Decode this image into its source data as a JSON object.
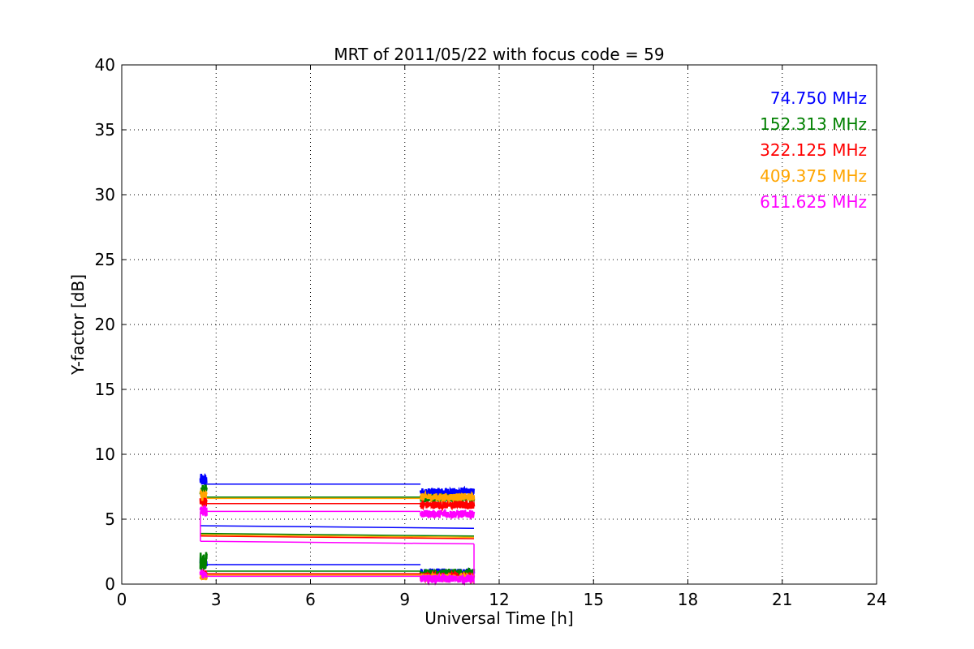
{
  "chart_data": {
    "type": "line",
    "title": "MRT of 2011/05/22 with focus code = 59",
    "xlabel": "Universal Time [h]",
    "ylabel": "Y-factor [dB]",
    "xlim": [
      0,
      24
    ],
    "ylim": [
      0,
      40
    ],
    "xticks": [
      0,
      3,
      6,
      9,
      12,
      15,
      18,
      21,
      24
    ],
    "yticks": [
      0,
      5,
      10,
      15,
      20,
      25,
      30,
      35,
      40
    ],
    "grid": true,
    "legend_position": "top-right",
    "series": [
      {
        "name": "74.750 MHz",
        "color": "#0000ff",
        "segments": [
          {
            "kind": "noisy",
            "x0": 2.5,
            "x1": 2.7,
            "center": 8.0,
            "amp": 0.5
          },
          {
            "kind": "noisy",
            "x0": 2.5,
            "x1": 2.7,
            "center": 1.7,
            "amp": 0.4
          },
          {
            "kind": "line",
            "x": [
              2.7,
              9.5
            ],
            "y": [
              7.7,
              7.7
            ]
          },
          {
            "kind": "line",
            "x": [
              2.7,
              9.5
            ],
            "y": [
              1.5,
              1.5
            ]
          },
          {
            "kind": "line",
            "x": [
              2.5,
              11.2
            ],
            "y": [
              4.5,
              4.3
            ]
          },
          {
            "kind": "noisy",
            "x0": 9.5,
            "x1": 11.2,
            "center": 7.1,
            "amp": 0.3
          },
          {
            "kind": "noisy",
            "x0": 9.5,
            "x1": 11.2,
            "center": 0.9,
            "amp": 0.3
          }
        ]
      },
      {
        "name": "152.313 MHz",
        "color": "#008000",
        "segments": [
          {
            "kind": "noisy",
            "x0": 2.5,
            "x1": 2.7,
            "center": 7.2,
            "amp": 0.5
          },
          {
            "kind": "noisy",
            "x0": 2.5,
            "x1": 2.7,
            "center": 1.8,
            "amp": 0.7
          },
          {
            "kind": "line",
            "x": [
              2.7,
              9.5
            ],
            "y": [
              6.7,
              6.7
            ]
          },
          {
            "kind": "line",
            "x": [
              2.7,
              9.5
            ],
            "y": [
              1.0,
              1.0
            ]
          },
          {
            "kind": "line",
            "x": [
              2.5,
              11.2
            ],
            "y": [
              3.9,
              3.7
            ]
          },
          {
            "kind": "noisy",
            "x0": 9.5,
            "x1": 11.2,
            "center": 6.6,
            "amp": 0.3
          },
          {
            "kind": "noisy",
            "x0": 9.5,
            "x1": 11.2,
            "center": 0.8,
            "amp": 0.4
          }
        ]
      },
      {
        "name": "322.125 MHz",
        "color": "#ff0000",
        "segments": [
          {
            "kind": "noisy",
            "x0": 2.5,
            "x1": 2.7,
            "center": 6.3,
            "amp": 0.4
          },
          {
            "kind": "noisy",
            "x0": 2.5,
            "x1": 2.7,
            "center": 0.8,
            "amp": 0.3
          },
          {
            "kind": "line",
            "x": [
              2.7,
              9.5
            ],
            "y": [
              6.2,
              6.2
            ]
          },
          {
            "kind": "line",
            "x": [
              2.7,
              9.5
            ],
            "y": [
              0.8,
              0.8
            ]
          },
          {
            "kind": "line",
            "x": [
              2.5,
              11.2
            ],
            "y": [
              3.7,
              3.5
            ]
          },
          {
            "kind": "noisy",
            "x0": 9.5,
            "x1": 11.2,
            "center": 6.1,
            "amp": 0.3
          },
          {
            "kind": "noisy",
            "x0": 9.5,
            "x1": 11.2,
            "center": 0.6,
            "amp": 0.3
          }
        ]
      },
      {
        "name": "409.375 MHz",
        "color": "#ffa500",
        "segments": [
          {
            "kind": "noisy",
            "x0": 2.5,
            "x1": 2.7,
            "center": 6.8,
            "amp": 0.4
          },
          {
            "kind": "noisy",
            "x0": 2.5,
            "x1": 2.7,
            "center": 0.6,
            "amp": 0.3
          },
          {
            "kind": "line",
            "x": [
              2.7,
              9.5
            ],
            "y": [
              6.6,
              6.6
            ]
          },
          {
            "kind": "line",
            "x": [
              2.7,
              9.5
            ],
            "y": [
              0.7,
              0.7
            ]
          },
          {
            "kind": "line",
            "x": [
              2.5,
              11.2
            ],
            "y": [
              3.8,
              3.6
            ]
          },
          {
            "kind": "noisy",
            "x0": 9.5,
            "x1": 11.2,
            "center": 6.7,
            "amp": 0.3
          },
          {
            "kind": "noisy",
            "x0": 9.5,
            "x1": 11.2,
            "center": 0.5,
            "amp": 0.3
          }
        ]
      },
      {
        "name": "611.625 MHz",
        "color": "#ff00ff",
        "segments": [
          {
            "kind": "noisy",
            "x0": 2.5,
            "x1": 2.7,
            "center": 5.6,
            "amp": 0.4
          },
          {
            "kind": "noisy",
            "x0": 2.5,
            "x1": 2.7,
            "center": 0.8,
            "amp": 0.3
          },
          {
            "kind": "line",
            "x": [
              2.7,
              9.5
            ],
            "y": [
              5.6,
              5.6
            ]
          },
          {
            "kind": "line",
            "x": [
              2.7,
              9.5
            ],
            "y": [
              0.6,
              0.6
            ]
          },
          {
            "kind": "line",
            "x": [
              2.5,
              11.2
            ],
            "y": [
              3.3,
              3.1
            ]
          },
          {
            "kind": "line",
            "x": [
              2.5,
              2.5
            ],
            "y": [
              3.3,
              5.6
            ]
          },
          {
            "kind": "line",
            "x": [
              11.2,
              11.2
            ],
            "y": [
              0.0,
              3.1
            ]
          },
          {
            "kind": "noisy",
            "x0": 9.5,
            "x1": 11.2,
            "center": 5.4,
            "amp": 0.3
          },
          {
            "kind": "noisy",
            "x0": 9.5,
            "x1": 11.2,
            "center": 0.4,
            "amp": 0.3
          }
        ]
      }
    ]
  }
}
